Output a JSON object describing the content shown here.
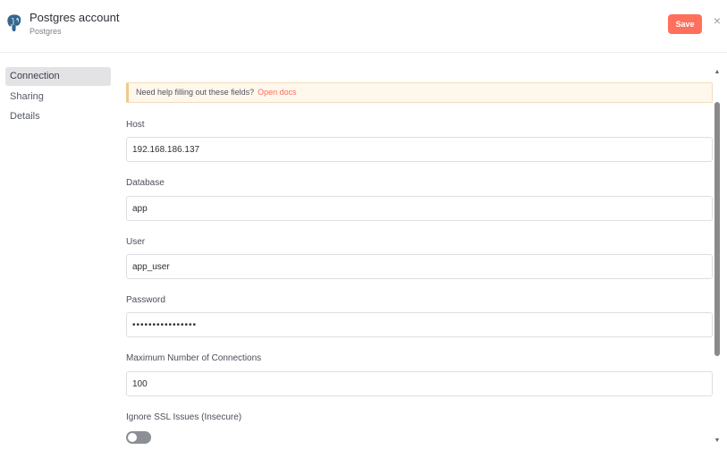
{
  "header": {
    "title": "Postgres account",
    "subtitle": "Postgres",
    "save_label": "Save",
    "close_glyph": "×",
    "logo_icon": "postgres-elephant-icon"
  },
  "sidebar": {
    "items": [
      {
        "label": "Connection",
        "active": true
      },
      {
        "label": "Sharing",
        "active": false
      },
      {
        "label": "Details",
        "active": false
      }
    ]
  },
  "notice": {
    "text": "Need help filling out these fields?",
    "link": "Open docs"
  },
  "fields": {
    "host": {
      "label": "Host",
      "value": "192.168.186.137"
    },
    "database": {
      "label": "Database",
      "value": "app"
    },
    "user": {
      "label": "User",
      "value": "app_user"
    },
    "password": {
      "label": "Password",
      "value": "••••••••••••••••"
    },
    "max_connections": {
      "label": "Maximum Number of Connections",
      "value": "100"
    },
    "ignore_ssl": {
      "label": "Ignore SSL Issues (Insecure)",
      "enabled": false
    }
  },
  "colors": {
    "accent": "#ff6f5b",
    "notice_bg": "#fef7ec",
    "toggle_off": "#8c8f95"
  }
}
